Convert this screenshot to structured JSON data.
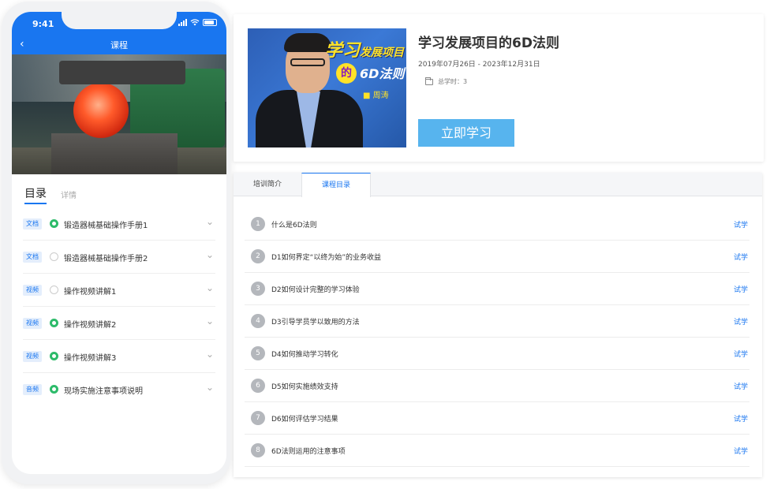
{
  "phone": {
    "status_time": "9:41",
    "nav_title": "课程",
    "tabs": {
      "active": "目录",
      "other": "详情"
    },
    "items": [
      {
        "badge": "文档",
        "label": "锻造器械基础操作手册1",
        "status": "done"
      },
      {
        "badge": "文档",
        "label": "锻造器械基础操作手册2",
        "status": "todo"
      },
      {
        "badge": "视频",
        "label": "操作视频讲解1",
        "status": "todo"
      },
      {
        "badge": "视频",
        "label": "操作视频讲解2",
        "status": "done"
      },
      {
        "badge": "视频",
        "label": "操作视频讲解3",
        "status": "done"
      },
      {
        "badge": "音频",
        "label": "现场实施注意事项说明",
        "status": "done"
      }
    ]
  },
  "course": {
    "title": "学习发展项目的6D法则",
    "dates": "2019年07月26日 - 2023年12月31日",
    "hours": "总学时：3",
    "study_button": "立即学习",
    "cover": {
      "line1": "学习",
      "line1b": "发展项目",
      "de": "的",
      "line2": "6D法则",
      "author": "■ 周涛"
    }
  },
  "catalog": {
    "tabs": [
      "培训简介",
      "课程目录"
    ],
    "try_label": "试学",
    "items": [
      {
        "num": "1",
        "label": "什么是6D法则"
      },
      {
        "num": "2",
        "label": "D1如何界定“以终为始”的业务收益"
      },
      {
        "num": "3",
        "label": "D2如何设计完整的学习体验"
      },
      {
        "num": "4",
        "label": "D3引导学员学以致用的方法"
      },
      {
        "num": "5",
        "label": "D4如何推动学习转化"
      },
      {
        "num": "6",
        "label": "D5如何实施绩效支持"
      },
      {
        "num": "7",
        "label": "D6如何评估学习结果"
      },
      {
        "num": "8",
        "label": "6D法则运用的注意事项"
      }
    ]
  },
  "colors": {
    "accent": "#1976f0",
    "button": "#57b4ee",
    "done": "#2dbb6a"
  }
}
